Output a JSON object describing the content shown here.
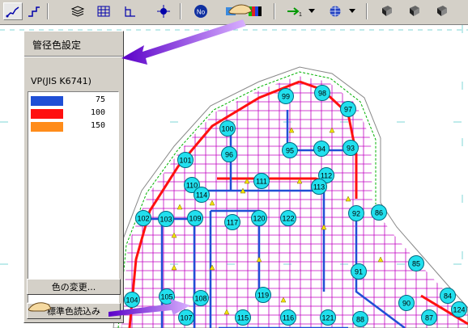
{
  "toolbar": {
    "buttons": [
      {
        "icon": "pipe-line-icon"
      },
      {
        "icon": "pipe-line-alt-icon"
      },
      {
        "icon": "layers-icon"
      },
      {
        "icon": "grid-icon"
      },
      {
        "icon": "axis-icon"
      },
      {
        "icon": "node-icon"
      },
      {
        "icon": "number-icon",
        "label": "No"
      },
      {
        "icon": "pipe-color-icon"
      },
      {
        "icon": "flow-direction-icon"
      },
      {
        "icon": "globe-icon"
      },
      {
        "icon": "book-icon"
      },
      {
        "icon": "book-icon"
      },
      {
        "icon": "book-icon"
      }
    ]
  },
  "panel": {
    "title": "管径色設定",
    "material": "VP(JIS K6741)",
    "rows": [
      {
        "size": "75",
        "color": "#1f4fd6"
      },
      {
        "size": "100",
        "color": "#ff1010"
      },
      {
        "size": "150",
        "color": "#ff8c1a"
      }
    ],
    "change_color_button": "色の変更...",
    "load_default_button": "標準色読込み"
  },
  "map": {
    "pipe_magenta": "#c000c0",
    "pipe_blue": "#1f4fd6",
    "pipe_red": "#ff1010",
    "node_fill": "#22e0ee",
    "arrow_fill": "#f2e600",
    "nodes": [
      "99",
      "98",
      "97",
      "100",
      "95",
      "94",
      "93",
      "96",
      "101",
      "112",
      "111",
      "110",
      "113",
      "114",
      "86",
      "92",
      "102",
      "103",
      "109",
      "117",
      "120",
      "122",
      "85",
      "91",
      "104",
      "105",
      "108",
      "119",
      "90",
      "84",
      "88",
      "124",
      "116",
      "87",
      "121",
      "107",
      "115"
    ]
  },
  "annotations": {
    "arrow_color": "#8a00d9"
  }
}
